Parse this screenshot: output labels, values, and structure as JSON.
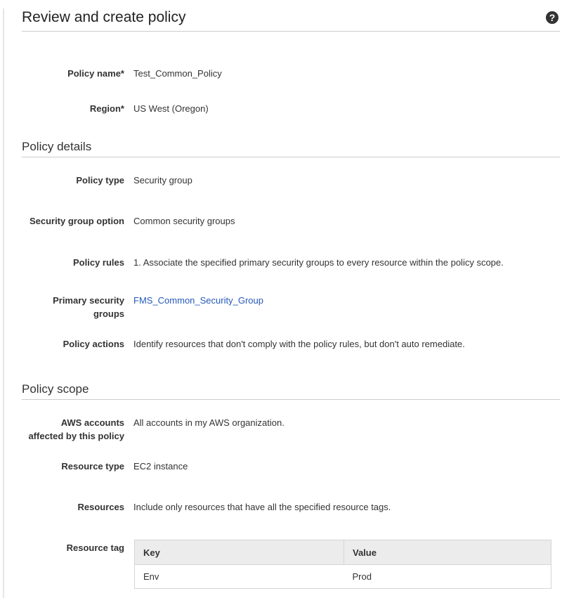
{
  "header": {
    "title": "Review and create policy",
    "help_icon": "question-circle-icon",
    "help_glyph": "?"
  },
  "basics": [
    {
      "label": "Policy name*",
      "value": "Test_Common_Policy"
    },
    {
      "label": "Region*",
      "value": "US West (Oregon)"
    }
  ],
  "policy_details": {
    "title": "Policy details",
    "rows": [
      {
        "label": "Policy type",
        "value": "Security group"
      },
      {
        "label": "Security group option",
        "value": "Common security groups"
      },
      {
        "label": "Policy rules",
        "value": "1. Associate the specified primary security groups to every resource within the policy scope."
      },
      {
        "label_line1": "Primary security",
        "label_line2": "groups",
        "value": "FMS_Common_Security_Group",
        "is_link": true
      },
      {
        "label": "Policy actions",
        "value": "Identify resources that don't comply with the policy rules, but don't auto remediate."
      }
    ]
  },
  "policy_scope": {
    "title": "Policy scope",
    "rows": [
      {
        "label_line1": "AWS accounts",
        "label_line2": "affected by this policy",
        "value": "All accounts in my AWS organization."
      },
      {
        "label": "Resource type",
        "value": "EC2 instance"
      },
      {
        "label": "Resources",
        "value": "Include only resources that have all the specified resource tags."
      },
      {
        "label": "Resource tag"
      }
    ],
    "tag_table": {
      "columns": [
        "Key",
        "Value"
      ],
      "rows": [
        [
          "Env",
          "Prod"
        ]
      ]
    }
  },
  "colors": {
    "link": "#2659b8",
    "text": "#333333",
    "divider": "#cccccc",
    "table_header_bg": "#ececec"
  }
}
